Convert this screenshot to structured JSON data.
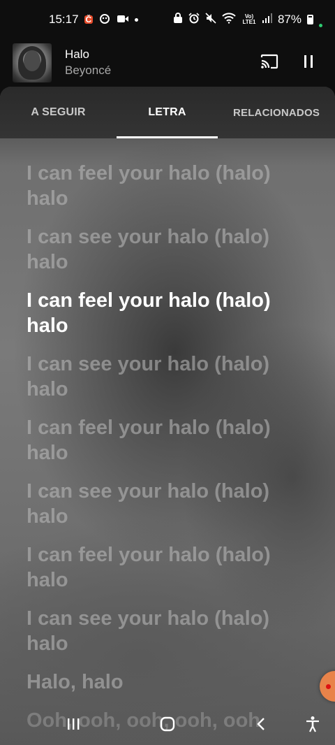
{
  "status_bar": {
    "time": "15:17",
    "notif_badge": "Č",
    "network": "Vo) LTE1",
    "battery": "87%"
  },
  "player": {
    "title": "Halo",
    "artist": "Beyoncé"
  },
  "tabs": [
    {
      "label": "A SEGUIR",
      "active": false
    },
    {
      "label": "LETRA",
      "active": true
    },
    {
      "label": "RELACIONADOS",
      "active": false
    }
  ],
  "lyrics": [
    {
      "line": "I can feel your halo (halo)",
      "cont": "halo",
      "state": "past"
    },
    {
      "line": "I can see your halo (halo)",
      "cont": "halo",
      "state": "past"
    },
    {
      "line": "I can feel your halo (halo)",
      "cont": "halo",
      "state": "current"
    },
    {
      "line": "I can see your halo (halo)",
      "cont": "halo",
      "state": "next"
    },
    {
      "line": "I can feel your halo (halo)",
      "cont": "halo",
      "state": "next"
    },
    {
      "line": "I can see your halo (halo)",
      "cont": "halo",
      "state": "next"
    },
    {
      "line": "I can feel your halo (halo)",
      "cont": "halo",
      "state": "next"
    },
    {
      "line": "I can see your halo (halo)",
      "cont": "halo",
      "state": "next"
    },
    {
      "line": "Halo, halo",
      "cont": "",
      "state": "next"
    },
    {
      "line": "Ooh, ooh, ooh, ooh, ooh",
      "cont": "",
      "state": "faded"
    }
  ],
  "icons": {
    "cast": "cast-icon",
    "pause": "pause-icon",
    "recents": "recents-icon",
    "home": "home-icon",
    "back": "back-icon",
    "accessibility": "accessibility-icon"
  }
}
